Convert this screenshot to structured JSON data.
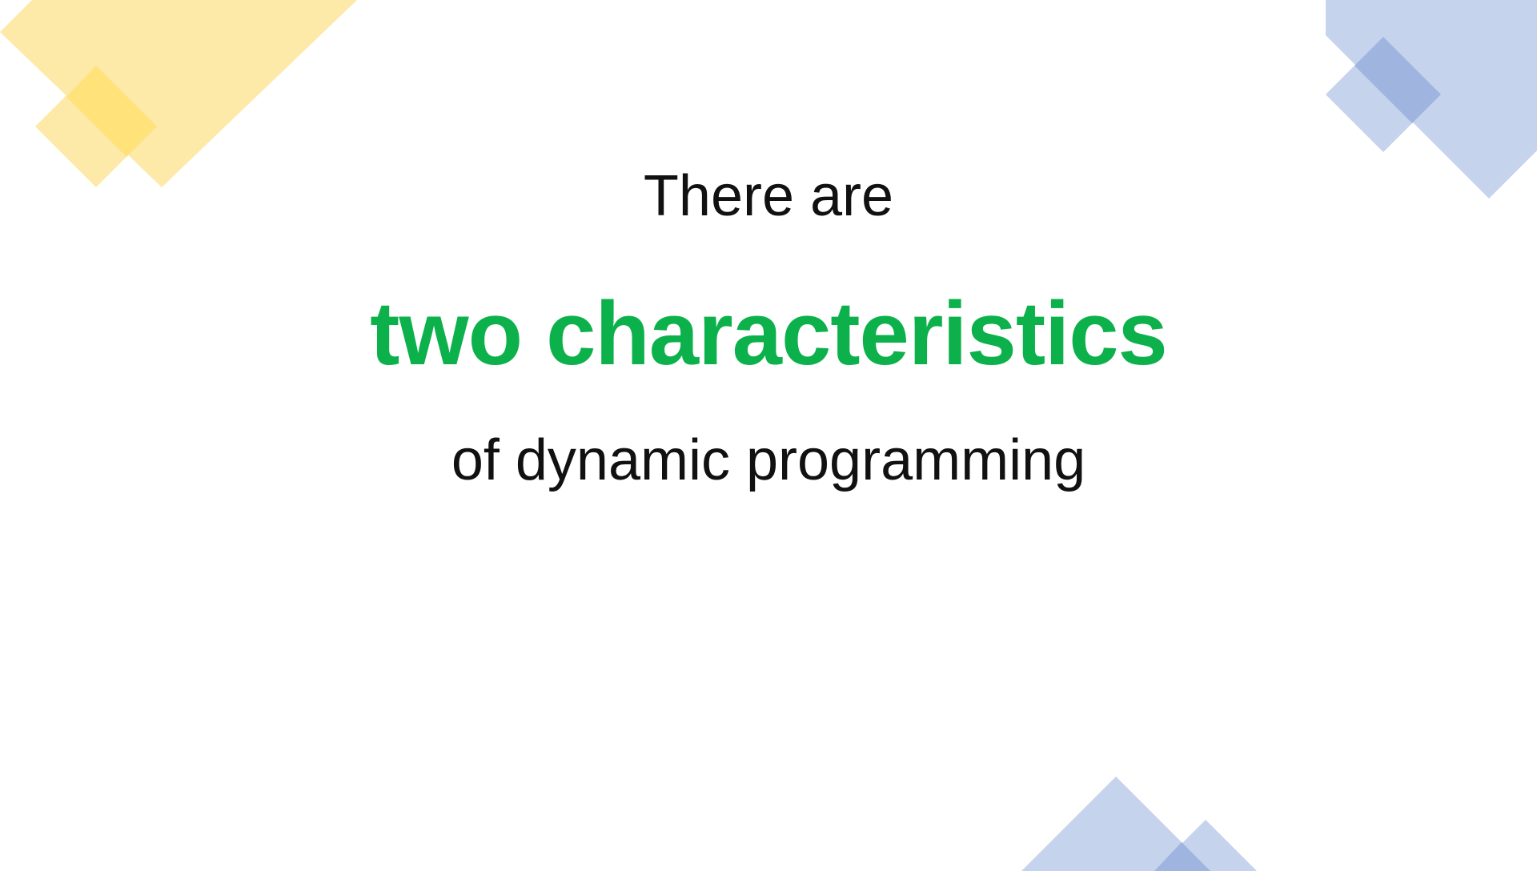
{
  "slide": {
    "line_1": "There are",
    "line_2": "two characteristics",
    "line_3": "of dynamic programming"
  },
  "colors": {
    "background": "#ffffff",
    "text": "#111111",
    "highlight": "#0DB14B",
    "yellow_shape": "#FDE9A8",
    "yellow_overlap": "#FFE27A",
    "blue_shape": "#C5D3ED",
    "blue_overlap": "#9FB5E0"
  }
}
